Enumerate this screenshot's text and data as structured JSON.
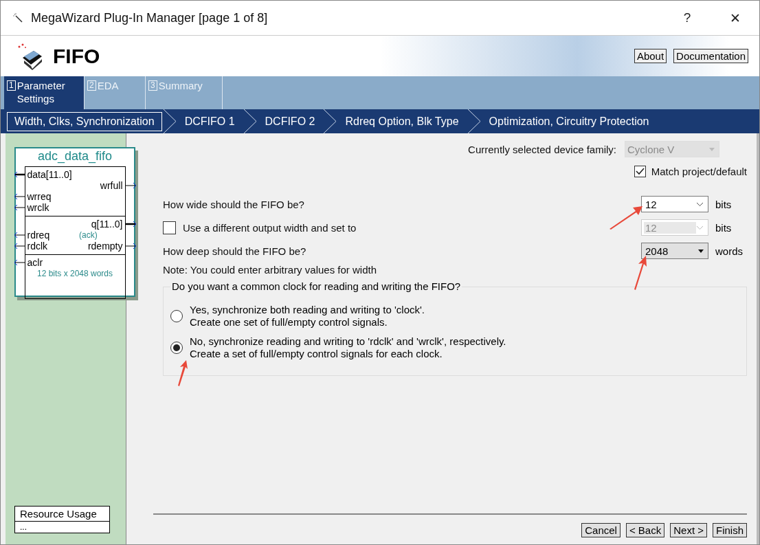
{
  "window": {
    "title": "MegaWizard Plug-In Manager [page 1 of 8]",
    "help": "?",
    "close": "✕"
  },
  "header": {
    "title": "FIFO",
    "links": [
      "About",
      "Documentation"
    ]
  },
  "tabs": [
    {
      "number": "1",
      "label": "Parameter Settings",
      "selected": true
    },
    {
      "number": "2",
      "label": "EDA",
      "selected": false
    },
    {
      "number": "3",
      "label": "Summary",
      "selected": false
    }
  ],
  "steps": [
    {
      "label": "Width, Clks, Synchronization",
      "selected": true
    },
    {
      "label": "DCFIFO 1",
      "selected": false
    },
    {
      "label": "DCFIFO 2",
      "selected": false
    },
    {
      "label": "Rdreq Option, Blk Type",
      "selected": false
    },
    {
      "label": "Optimization, Circuitry Protection",
      "selected": false
    }
  ],
  "symbol": {
    "title": "adc_data_fifo",
    "sections": [
      {
        "rows": [
          {
            "in": {
              "name": "data[11..0]",
              "bus": true
            }
          },
          {
            "out": {
              "name": "wrfull",
              "bus": false
            }
          },
          {
            "in": {
              "name": "wrreq",
              "bus": false
            }
          },
          {
            "in": {
              "name": "wrclk",
              "bus": false
            }
          }
        ]
      },
      {
        "rows": [
          {
            "out": {
              "name": "q[11..0]",
              "bus": true
            }
          },
          {
            "in": {
              "name": "rdreq",
              "bus": false
            },
            "note": "(ack)"
          },
          {
            "in": {
              "name": "rdclk",
              "bus": false
            },
            "out": {
              "name": "rdempty",
              "bus": false
            }
          }
        ]
      },
      {
        "rows": [
          {
            "in": {
              "name": "aclr",
              "bus": false
            }
          },
          {
            "note": "12 bits x 2048 words"
          }
        ]
      }
    ]
  },
  "resource_usage": {
    "title": "Resource Usage",
    "value": "..."
  },
  "device_family": {
    "label": "Currently selected device family:",
    "value": "Cyclone V",
    "disabled": true
  },
  "match_project": {
    "label": "Match project/default",
    "checked": true
  },
  "fields": [
    {
      "kind": "combo",
      "label": "How wide should the FIFO be?",
      "value": "12",
      "unit": "bits",
      "disabled": false
    },
    {
      "kind": "check",
      "label": "Use a different output width and set to",
      "checked": false,
      "value": "12",
      "unit": "bits",
      "disabled": true
    },
    {
      "kind": "dropdown",
      "label": "How deep should the FIFO be?",
      "value": "2048",
      "unit": "words",
      "disabled": false
    }
  ],
  "note": "Note: You could enter arbitrary values for width",
  "clock_group": {
    "legend": "Do you want a common clock for reading and writing the FIFO?",
    "options": [
      {
        "lines": [
          "Yes, synchronize both reading and writing to 'clock'.",
          "Create one set of full/empty control signals."
        ],
        "selected": false
      },
      {
        "lines": [
          "No, synchronize reading and writing to 'rdclk' and 'wrclk', respectively.",
          "Create a set of full/empty control signals for each clock."
        ],
        "selected": true
      }
    ]
  },
  "buttons": [
    "Cancel",
    "< Back",
    "Next >",
    "Finish"
  ]
}
